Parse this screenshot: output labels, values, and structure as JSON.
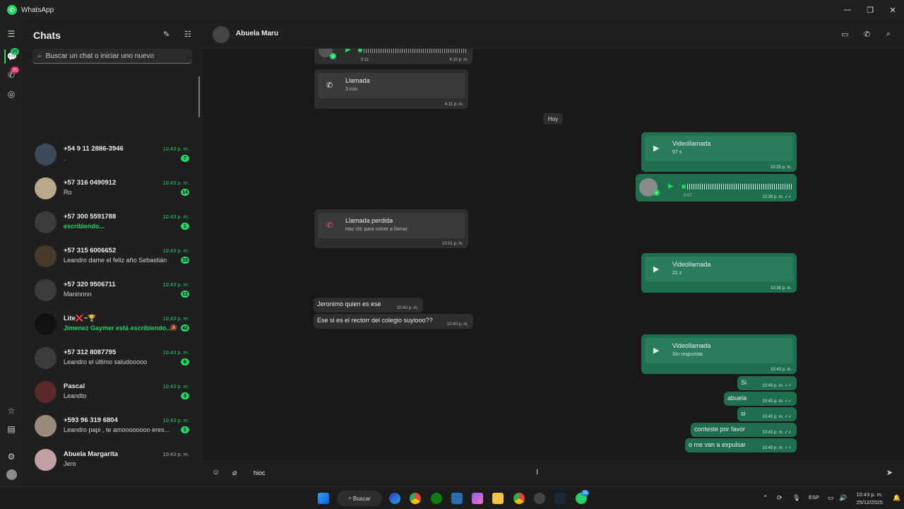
{
  "window": {
    "title": "WhatsApp",
    "controls": [
      "—",
      "❐",
      "✕"
    ]
  },
  "rail": {
    "chats_badge": "25",
    "calls_badge": "20"
  },
  "chatlist": {
    "title": "Chats",
    "search_placeholder": "Buscar un chat o iniciar uno nuevo",
    "items": [
      {
        "name": "+54 9 11 2886-3946",
        "time": "10:43 p. m.",
        "preview": ".",
        "unread": "7",
        "avatar_color": "#3a4a5a"
      },
      {
        "name": "+57 316 0490912",
        "time": "10:43 p. m.",
        "preview": "Ro",
        "unread": "14",
        "avatar_color": "#b9a98a"
      },
      {
        "name": "+57 300 5591788",
        "time": "10:43 p. m.",
        "preview": "escribiendo...",
        "unread": "1",
        "avatar_color": "#3b3b3b"
      },
      {
        "name": "+57 315 6006652",
        "time": "10:43 p. m.",
        "preview": "Leandro dame el feliz año Sebastián",
        "unread": "18",
        "avatar_color": "#4a3a2a"
      },
      {
        "name": "+57 320 9506711",
        "time": "10:43 p. m.",
        "preview": "Maninnnn",
        "unread": "12",
        "avatar_color": "#3b3b3b"
      },
      {
        "name": "Lite❌~🏆",
        "time": "10:43 p. m.",
        "preview": "Jimenez Gaymer está escribiendo...",
        "unread": "42",
        "avatar_color": "#111111"
      },
      {
        "name": "+57 312 8087795",
        "time": "10:43 p. m.",
        "preview": "Leandro el último saludooooo",
        "unread": "6",
        "avatar_color": "#3b3b3b"
      },
      {
        "name": "Pascal",
        "time": "10:43 p. m.",
        "preview": "Leandto",
        "unread": "3",
        "avatar_color": "#5a2a2a"
      },
      {
        "name": "+593 96 319 6804",
        "time": "10:43 p. m.",
        "preview": "Leandro papi , te amoooooooo eres...",
        "unread": "1",
        "avatar_color": "#9a8a7a"
      },
      {
        "name": "Abuela Margarita",
        "time": "10:43 p. m.",
        "preview": "Jero",
        "unread": "",
        "avatar_color": "#c0a0a0"
      }
    ]
  },
  "conversation": {
    "contact": "Abuela Maru",
    "date_chip": "Hoy",
    "voice1": {
      "duration": "0:11",
      "time": "4:10 p. m."
    },
    "call1": {
      "title": "Llamada",
      "sub": "3 min",
      "time": "4:11 p. m."
    },
    "video1": {
      "title": "Videollamada",
      "sub": "57 s",
      "time": "10:25 p. m."
    },
    "voice2": {
      "duration": "0:07",
      "time": "10:26 p. m. ✓✓"
    },
    "missed": {
      "title": "Llamada perdida",
      "sub": "Haz clic para volver a llamar.",
      "time": "10:31 p. m."
    },
    "video2": {
      "title": "Videollamada",
      "sub": "21 s",
      "time": "10:36 p. m."
    },
    "in1": {
      "text": "Jeronimo quien es ese",
      "time": "10:40 p. m."
    },
    "in2": {
      "text": "Ese si es el rectorr del colegio suyiooo??",
      "time": "10:40 p. m."
    },
    "video3": {
      "title": "Videollamada",
      "sub": "Sin respuesta",
      "time": "10:43 p. m."
    },
    "out_msgs": [
      {
        "text": "Si",
        "time": "10:43 p. m. ✓✓"
      },
      {
        "text": "abuela",
        "time": "10:43 p. m. ✓✓"
      },
      {
        "text": "si",
        "time": "10:43 p. m. ✓✓"
      },
      {
        "text": "conteste por favor",
        "time": "10:43 p. m. ✓✓"
      },
      {
        "text": "o me van a expulsar",
        "time": "10:43 p. m. ✓✓"
      }
    ]
  },
  "composer": {
    "draft": "hioc"
  },
  "taskbar": {
    "search_label": "Buscar",
    "lang": "ESP",
    "clock_time": "10:43 p. m.",
    "clock_date": "25/12/2025",
    "whatsapp_badge": "25"
  }
}
